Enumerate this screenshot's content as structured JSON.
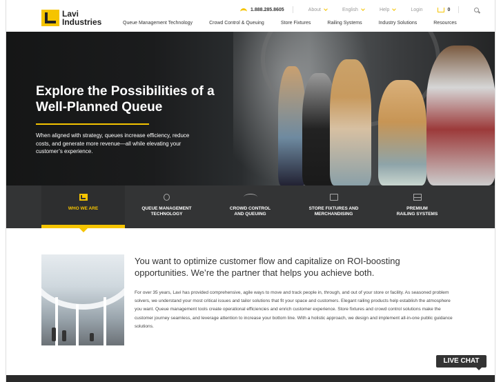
{
  "header": {
    "logo_line1": "Lavi",
    "logo_line2": "Industries",
    "phone": "1.888.285.8605",
    "about": "About",
    "language": "English",
    "help": "Help",
    "login": "Login",
    "cart_count": "0",
    "nav": [
      "Queue Management Technology",
      "Crowd Control & Queuing",
      "Store Fixtures",
      "Railing Systems",
      "Industry Solutions",
      "Resources"
    ]
  },
  "hero": {
    "title": "Explore the Possibilities of a Well-Planned Queue",
    "body": "When aligned with strategy, queues increase efficiency, reduce costs, and generate more revenue—all while elevating your customer’s experience."
  },
  "categories": [
    {
      "line1": "WHO WE ARE",
      "line2": "",
      "icon": "lavi-logo-icon",
      "active": true
    },
    {
      "line1": "QUEUE MANAGEMENT",
      "line2": "TECHNOLOGY",
      "icon": "queue-tech-icon",
      "active": false
    },
    {
      "line1": "CROWD CONTROL",
      "line2": "AND QUEUING",
      "icon": "crowd-icon",
      "active": false
    },
    {
      "line1": "STORE FIXTURES AND",
      "line2": "MERCHANDISING",
      "icon": "shopping-bag-icon",
      "active": false
    },
    {
      "line1": "PREMIUM",
      "line2": "RAILING SYSTEMS",
      "icon": "railing-icon",
      "active": false
    }
  ],
  "about": {
    "heading": "You want to optimize customer flow and capitalize on ROI-boosting opportunities. We’re the partner that helps you achieve both.",
    "body": "For over 35 years, Lavi has provided comprehensive, agile ways to move and track people in, through, and out of your store or facility. As seasoned problem solvers, we understand your most critical issues and tailor solutions that fit your space and customers. Elegant railing products help establish the atmosphere you want. Queue management tools create operational efficiencies and enrich customer experience. Store fixtures and crowd control solutions make the customer journey seamless, and leverage attention to increase your bottom line. With a holistic approach, we design and implement all-in-one public guidance solutions."
  },
  "livechat": "LIVE CHAT",
  "colors": {
    "accent": "#f5c400",
    "dark_band": "#333435"
  }
}
